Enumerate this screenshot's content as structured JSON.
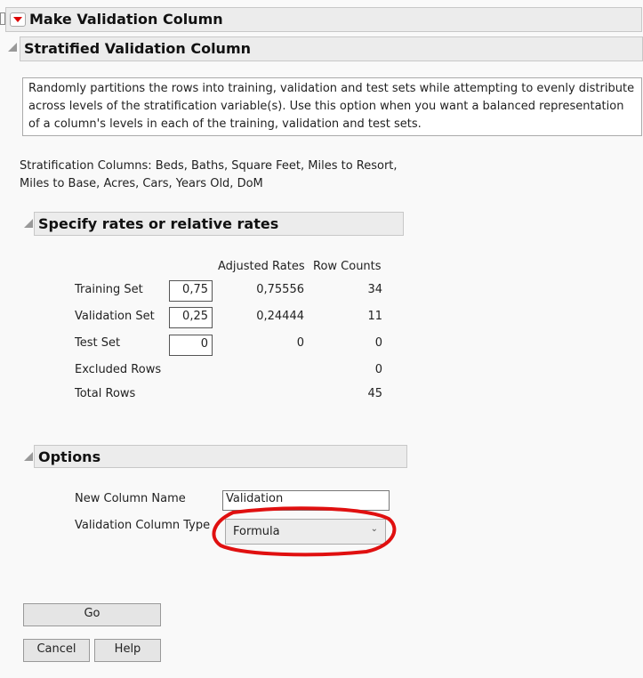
{
  "title": "Make Validation Column",
  "section": "Stratified Validation Column",
  "description": "Randomly partitions the rows into training, validation and test sets while attempting to evenly distribute across levels of the stratification variable(s). Use this option when you want a balanced representation of a column's levels in each of the training, validation and test sets.",
  "strat_line1": "Stratification Columns: Beds, Baths, Square Feet, Miles to Resort,",
  "strat_line2": "Miles to Base, Acres, Cars, Years Old, DoM",
  "rates": {
    "title": "Specify rates or relative rates",
    "col_adj": "Adjusted Rates",
    "col_cnt": "Row Counts",
    "rows": [
      {
        "label": "Training Set",
        "input": "0,75",
        "adj": "0,75556",
        "count": "34"
      },
      {
        "label": "Validation Set",
        "input": "0,25",
        "adj": "0,24444",
        "count": "11"
      },
      {
        "label": "Test Set",
        "input": "0",
        "adj": "0",
        "count": "0"
      }
    ],
    "excluded_label": "Excluded Rows",
    "excluded": "0",
    "total_label": "Total Rows",
    "total": "45"
  },
  "options": {
    "title": "Options",
    "name_label": "New Column Name",
    "name_value": "Validation",
    "type_label": "Validation Column Type",
    "type_value": "Formula"
  },
  "buttons": {
    "go": "Go",
    "cancel": "Cancel",
    "help": "Help"
  }
}
